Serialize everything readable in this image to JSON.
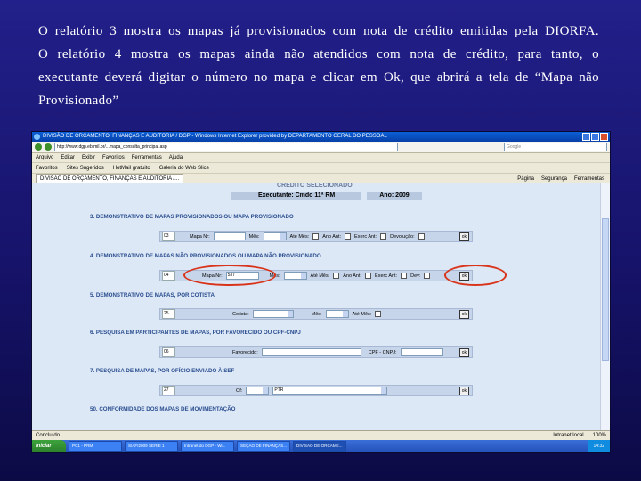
{
  "caption": {
    "line1": "O relatório 3 mostra os mapas já provisionados com nota de crédito emitidas pela DIORFA.",
    "line2": "O relatório 4 mostra os mapas ainda não atendidos com nota de crédito, para tanto, o",
    "line3": "executante deverá digitar o número no mapa e clicar em Ok, que abrirá a tela de “Mapa não",
    "line4": "Provisionado”"
  },
  "browser": {
    "title": "DIVISÃO DE ORÇAMENTO, FINANÇAS E AUDITORIA / DGP - Windows Internet Explorer provided by DEPARTAMENTO GERAL DO PESSOAL",
    "address": "http://www.dgp.eb.mil.br/...mapa_consulta_principal.asp",
    "search_placeholder": "Google",
    "menu": [
      "Arquivo",
      "Editar",
      "Exibir",
      "Favoritos",
      "Ferramentas",
      "Ajuda"
    ],
    "favorites": [
      "Favoritos",
      "Sites Sugeridos",
      "HotMail gratuito",
      "Galeria do Web Slice"
    ],
    "tab": "DIVISÃO DE ORÇAMENTO, FINANÇAS E AUDITORIA /...",
    "tab_tools": [
      "Página",
      "Segurança",
      "Ferramentas"
    ],
    "status_left": "Concluído",
    "status_zone": "Intranet local",
    "zoom": "100%"
  },
  "page": {
    "header_cut": "CREDITO SELECIONADO",
    "executante": "Executante: Cmdo 11ª RM",
    "ano": "Ano: 2009",
    "sec3": {
      "title": "3. DEMONSTRATIVO DE MAPAS PROVISIONADOS OU MAPA PROVISIONADO",
      "code": "03",
      "mapa_label": "Mapa Nr:",
      "mes_label": "Mês:",
      "ate_mes": "Até Mês:",
      "ano_ant": "Ano Ant:",
      "exerc_ant": "Exerc Ant:",
      "devolucao": "Devolução:",
      "ok": "ok"
    },
    "sec4": {
      "title": "4. DEMONSTRATIVO DE MAPAS NÃO PROVISIONADOS OU MAPA NÃO PROVISIONADO",
      "code": "04",
      "mapa_label": "Mapa Nr:",
      "mapa_value": "537",
      "mes_label": "Mês:",
      "ate_mes": "Até Mês:",
      "ano_ant": "Ano Ant:",
      "exerc_ant": "Exerc Ant:",
      "dev": "Dev:",
      "ok": "ok"
    },
    "sec5": {
      "title": "5. DEMONSTRATIVO DE MAPAS, POR COTISTA",
      "code": "25",
      "cotista_label": "Cotista:",
      "mes_label": "Mês:",
      "ate_mes": "Até Mês:",
      "ok": "ok"
    },
    "sec6": {
      "title": "6. PESQUISA EM PARTICIPANTES DE MAPAS, POR FAVORECIDO OU CPF-CNPJ",
      "code": "06",
      "favorecido_label": "Favorecido:",
      "cpf_label": "CPF - CNPJ:",
      "ok": "ok"
    },
    "sec7": {
      "title": "7. PESQUISA DE MAPAS, POR OFÍCIO ENVIADO À SEF",
      "code": "27",
      "of_label": "Of:",
      "ptr_value": "PTR",
      "ok": "ok"
    },
    "sec50": {
      "title": "50. CONFORMIDADE DOS MAPAS DE MOVIMENTAÇÃO"
    }
  },
  "taskbar": {
    "start": "Iniciar",
    "tasks": [
      "PC1 - PRM",
      "SIAFI2009 SERIE 1",
      "Intranet do DGP - Wi...",
      "SEÇÃO DE FINANÇAS...",
      "DIVISÃO DE ORÇAME..."
    ],
    "tray": "14:32"
  },
  "colors": {
    "background": "#1c1a7a",
    "highlight": "#d9341a",
    "section_title": "#2a4d8f"
  }
}
